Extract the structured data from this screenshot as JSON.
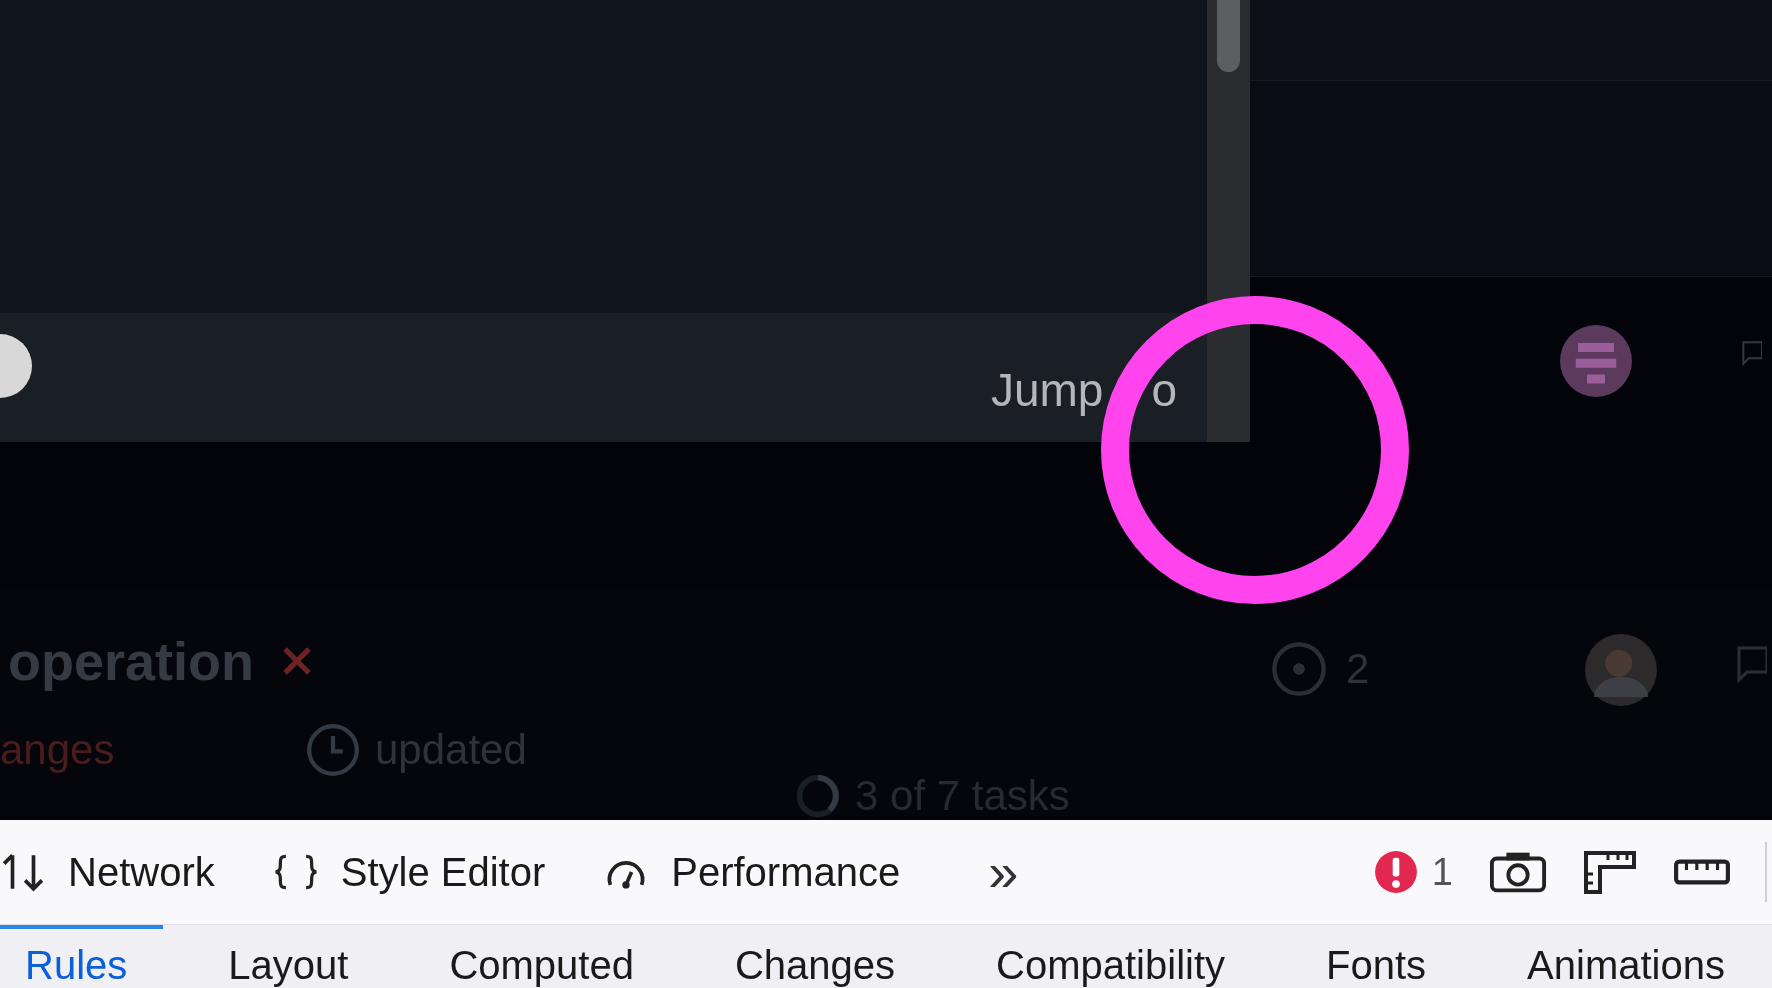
{
  "popup": {
    "jump_label": "Jump",
    "jump_tail": "o"
  },
  "list_row": {
    "title": "operation",
    "status": "anges",
    "updated": "updated",
    "tasks": "3 of 7 tasks",
    "count": "2",
    "failed": true
  },
  "toolbar": {
    "tools": [
      {
        "kind": "network",
        "label": "Network"
      },
      {
        "kind": "style",
        "label": "Style Editor"
      },
      {
        "kind": "performance",
        "label": "Performance"
      }
    ],
    "more": "»",
    "errors": "1"
  },
  "panel_tabs": [
    {
      "label": "Rules",
      "selected": true
    },
    {
      "label": "Layout",
      "selected": false
    },
    {
      "label": "Computed",
      "selected": false
    },
    {
      "label": "Changes",
      "selected": false
    },
    {
      "label": "Compatibility",
      "selected": false
    },
    {
      "label": "Fonts",
      "selected": false
    },
    {
      "label": "Animations",
      "selected": false
    }
  ]
}
